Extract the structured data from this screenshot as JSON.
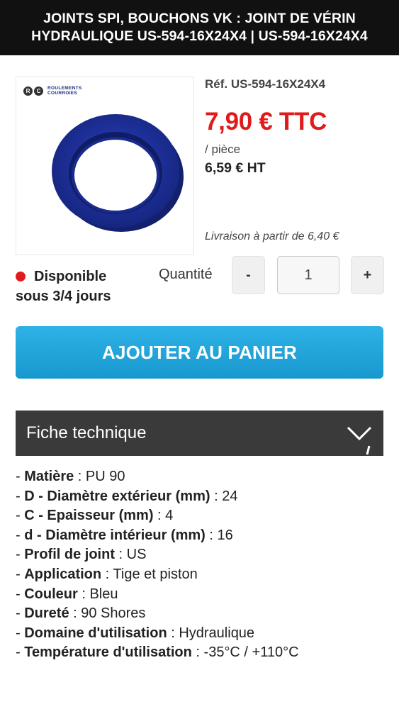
{
  "header": {
    "title": "JOINTS SPI, BOUCHONS VK : JOINT DE VÉRIN HYDRAULIQUE US-594-16X24X4 | US-594-16X24X4"
  },
  "image": {
    "logo_circles": [
      "R",
      "C"
    ],
    "logo_line1": "ROULEMENTS",
    "logo_line2": "COURROIES",
    "ring_color": "#1c2f9e"
  },
  "product": {
    "ref": "Réf. US-594-16X24X4",
    "price_ttc": "7,90 € TTC",
    "per_piece": "/ pièce",
    "price_ht": "6,59 € HT",
    "delivery": "Livraison à partir de 6,40 €"
  },
  "availability": {
    "line1": "Disponible",
    "line2": "sous 3/4 jours",
    "dot_color": "#e01b1b"
  },
  "quantity": {
    "label": "Quantité",
    "minus": "-",
    "plus": "+",
    "value": "1"
  },
  "cart": {
    "button_label": "AJOUTER AU PANIER",
    "color": "#1ea3da"
  },
  "fiche": {
    "title": "Fiche technique",
    "specs": [
      {
        "key": "Matière",
        "value": "PU 90"
      },
      {
        "key": "D - Diamètre extérieur (mm)",
        "value": "24"
      },
      {
        "key": "C - Epaisseur (mm)",
        "value": "4"
      },
      {
        "key": "d - Diamètre intérieur (mm)",
        "value": "16"
      },
      {
        "key": "Profil de joint",
        "value": "US"
      },
      {
        "key": "Application",
        "value": "Tige et piston"
      },
      {
        "key": "Couleur",
        "value": "Bleu"
      },
      {
        "key": "Dureté",
        "value": "90 Shores"
      },
      {
        "key": "Domaine d'utilisation",
        "value": "Hydraulique"
      },
      {
        "key": "Température d'utilisation",
        "value": "-35°C / +110°C"
      }
    ]
  },
  "colors": {
    "price_red": "#e01b1b",
    "header_bg": "#111111",
    "fiche_bg": "#3a3a3a"
  }
}
